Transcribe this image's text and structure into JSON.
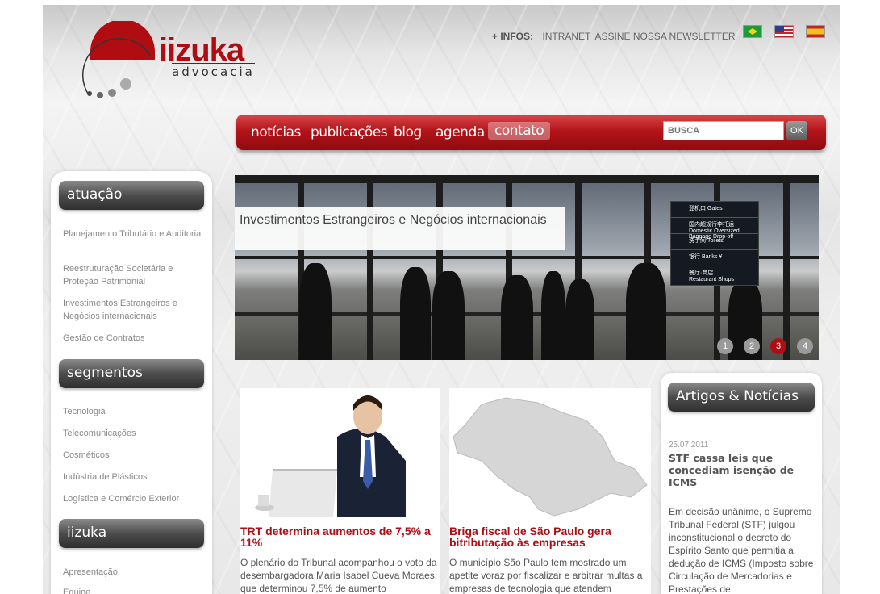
{
  "header": {
    "logo_word": "iizuka",
    "logo_sub": "advocacia",
    "infos_label": "+ INFOS:",
    "infos_links": [
      "INTRANET",
      "ASSINE NOSSA NEWSLETTER"
    ],
    "flags": [
      "brazil-flag",
      "usa-flag",
      "spain-flag"
    ]
  },
  "nav": {
    "items": [
      "notícias",
      "publicações",
      "blog",
      "agenda",
      "contato"
    ],
    "active": "contato",
    "search_placeholder": "BUSCA",
    "search_button": "OK"
  },
  "sidebar": {
    "sections": [
      {
        "title": "atuação",
        "items": [
          "Planejamento Tributário e Auditoria",
          "Reestruturação Societária e Proteção Patrimonial",
          "Investimentos Estrangeiros e Negócios internacionais",
          "Gestão de Contratos"
        ]
      },
      {
        "title": "segmentos",
        "items": [
          "Tecnologia",
          "Telecomunicações",
          "Cosméticos",
          "Indústria de Plásticos",
          "Logística e Comércio Exterior"
        ]
      },
      {
        "title": "iizuka",
        "items": [
          "Apresentação",
          "Equipe"
        ]
      }
    ]
  },
  "banner": {
    "caption": "Investimentos Estrangeiros e Negócios internacionais",
    "slides": [
      "1",
      "2",
      "3",
      "4"
    ],
    "active_slide": "3",
    "sign_rows": [
      "登机口 Gates",
      "国内超规行李托运 Domestic Oversized Baggage Drop-off",
      "洗手间 Toilets",
      "银行 Banks ¥",
      "餐厅·商店 Restaurant Shops"
    ]
  },
  "cards": [
    {
      "title": "TRT determina aumentos de 7,5% a 11%",
      "text": "O plenário do Tribunal acompanhou o voto da desembargadora Maria Isabel Cueva Moraes, que determinou 7,5% de aumento"
    },
    {
      "title": "Briga fiscal de São Paulo gera bitributação às empresas",
      "text": "O município São Paulo tem mostrado um apetite voraz por fiscalizar e arbitrar multas a empresas de tecnologia que atendem"
    }
  ],
  "news": {
    "heading": "Artigos & Notícias",
    "date": "25.07.2011",
    "title": "STF cassa leis que concediam isenção de ICMS",
    "text": "Em decisão unânime, o Supremo Tribunal Federal (STF) julgou inconstitucional o decreto do Espírito Santo que permitia a dedução de ICMS (Imposto sobre Circulação de Mercadorias e Prestações de"
  },
  "colors": {
    "brand_red": "#b00d13",
    "nav_red": "#b31419",
    "text_gray": "#8a8a8a"
  }
}
